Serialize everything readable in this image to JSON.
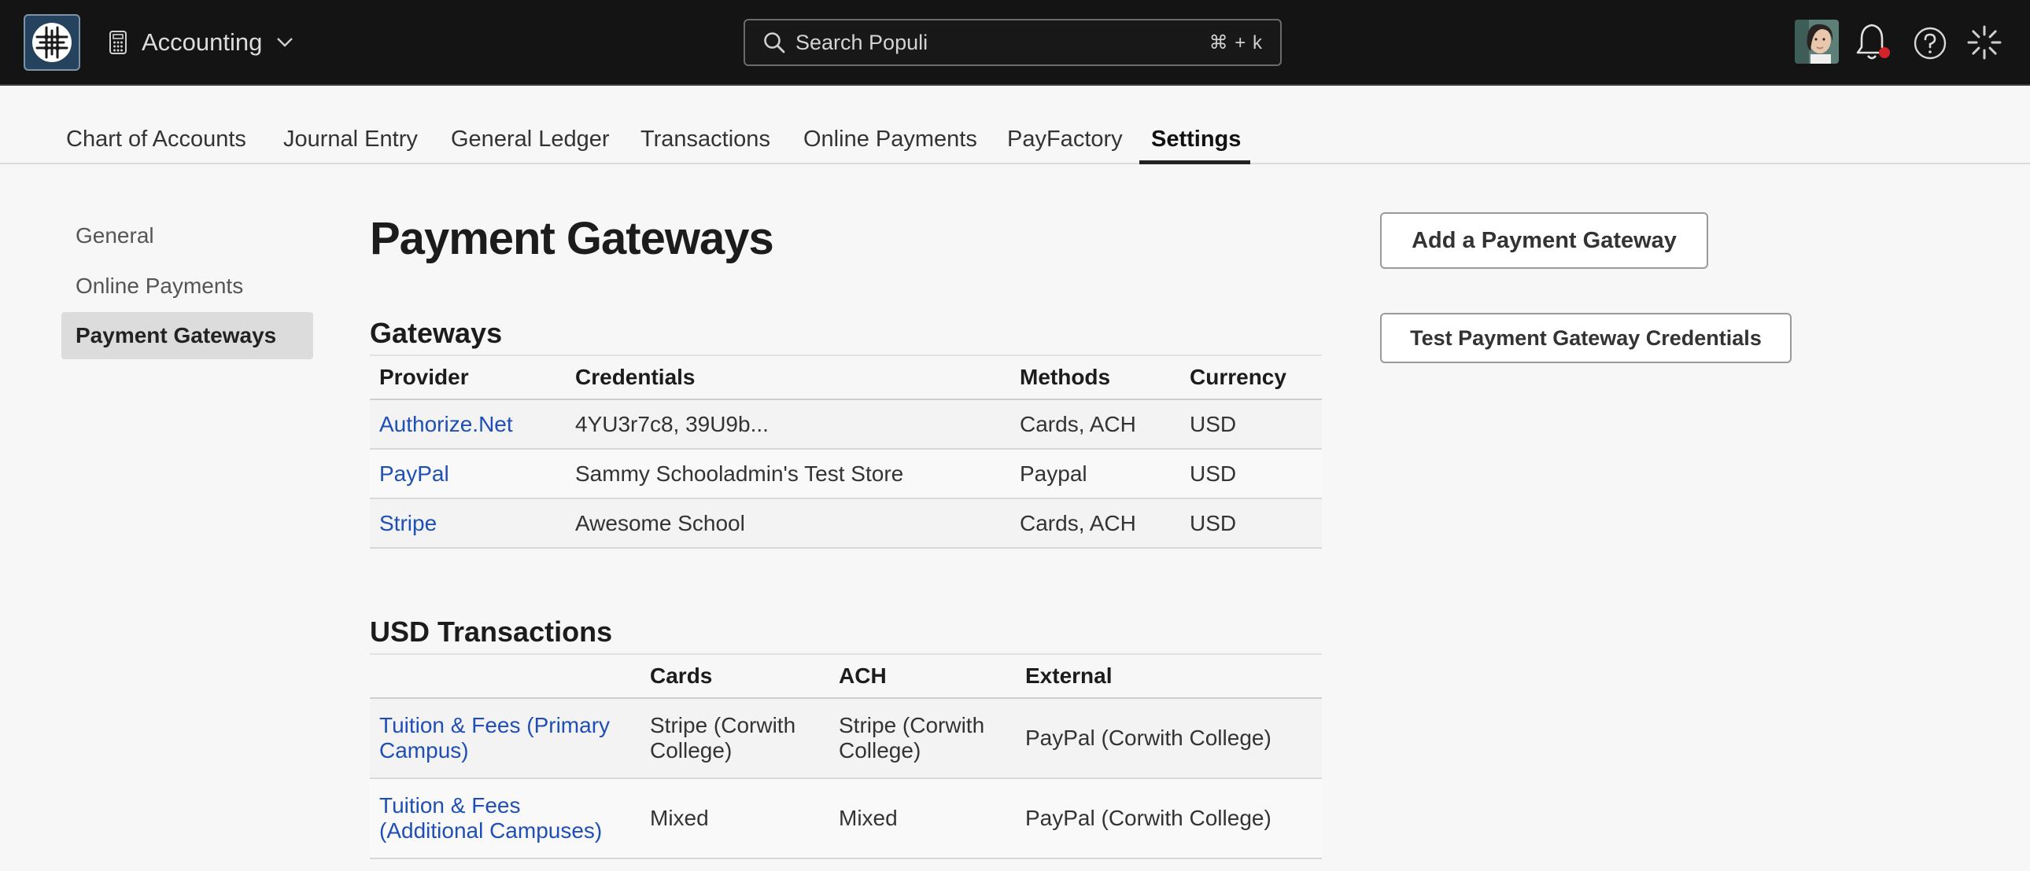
{
  "topbar": {
    "app_name": "Accounting",
    "search_placeholder": "Search Populi",
    "search_shortcut": "⌘ + k"
  },
  "tabs": [
    {
      "label": "Chart of Accounts"
    },
    {
      "label": "Journal Entry"
    },
    {
      "label": "General Ledger"
    },
    {
      "label": "Transactions"
    },
    {
      "label": "Online Payments"
    },
    {
      "label": "PayFactory"
    },
    {
      "label": "Settings",
      "active": true
    }
  ],
  "sidebar": {
    "items": [
      {
        "label": "General"
      },
      {
        "label": "Online Payments"
      },
      {
        "label": "Payment Gateways",
        "active": true
      }
    ]
  },
  "main": {
    "title": "Payment Gateways",
    "gateways": {
      "heading": "Gateways",
      "columns": [
        "Provider",
        "Credentials",
        "Methods",
        "Currency"
      ],
      "rows": [
        {
          "provider": "Authorize.Net",
          "credentials": "4YU3r7c8, 39U9b...",
          "methods": "Cards, ACH",
          "currency": "USD"
        },
        {
          "provider": "PayPal",
          "credentials": "Sammy Schooladmin's Test Store",
          "methods": "Paypal",
          "currency": "USD"
        },
        {
          "provider": "Stripe",
          "credentials": "Awesome School",
          "methods": "Cards, ACH",
          "currency": "USD"
        }
      ]
    },
    "usd_transactions": {
      "heading": "USD Transactions",
      "columns": [
        "",
        "Cards",
        "ACH",
        "External"
      ],
      "rows": [
        {
          "name_line1": "Tuition & Fees (Primary",
          "name_line2": "Campus)",
          "cards_line1": "Stripe (Corwith",
          "cards_line2": "College)",
          "ach_line1": "Stripe (Corwith",
          "ach_line2": "College)",
          "external": "PayPal (Corwith College)"
        },
        {
          "name_line1": "Tuition & Fees",
          "name_line2": "(Additional Campuses)",
          "cards": "Mixed",
          "ach": "Mixed",
          "external": "PayPal (Corwith College)"
        }
      ]
    }
  },
  "actions": {
    "add_gateway": "Add a Payment Gateway",
    "test_credentials": "Test Payment Gateway Credentials"
  },
  "colors": {
    "topbar_bg": "#141414",
    "link": "#1f4fb5",
    "green_text": "#336b1a",
    "notification_dot": "#d0232a"
  }
}
